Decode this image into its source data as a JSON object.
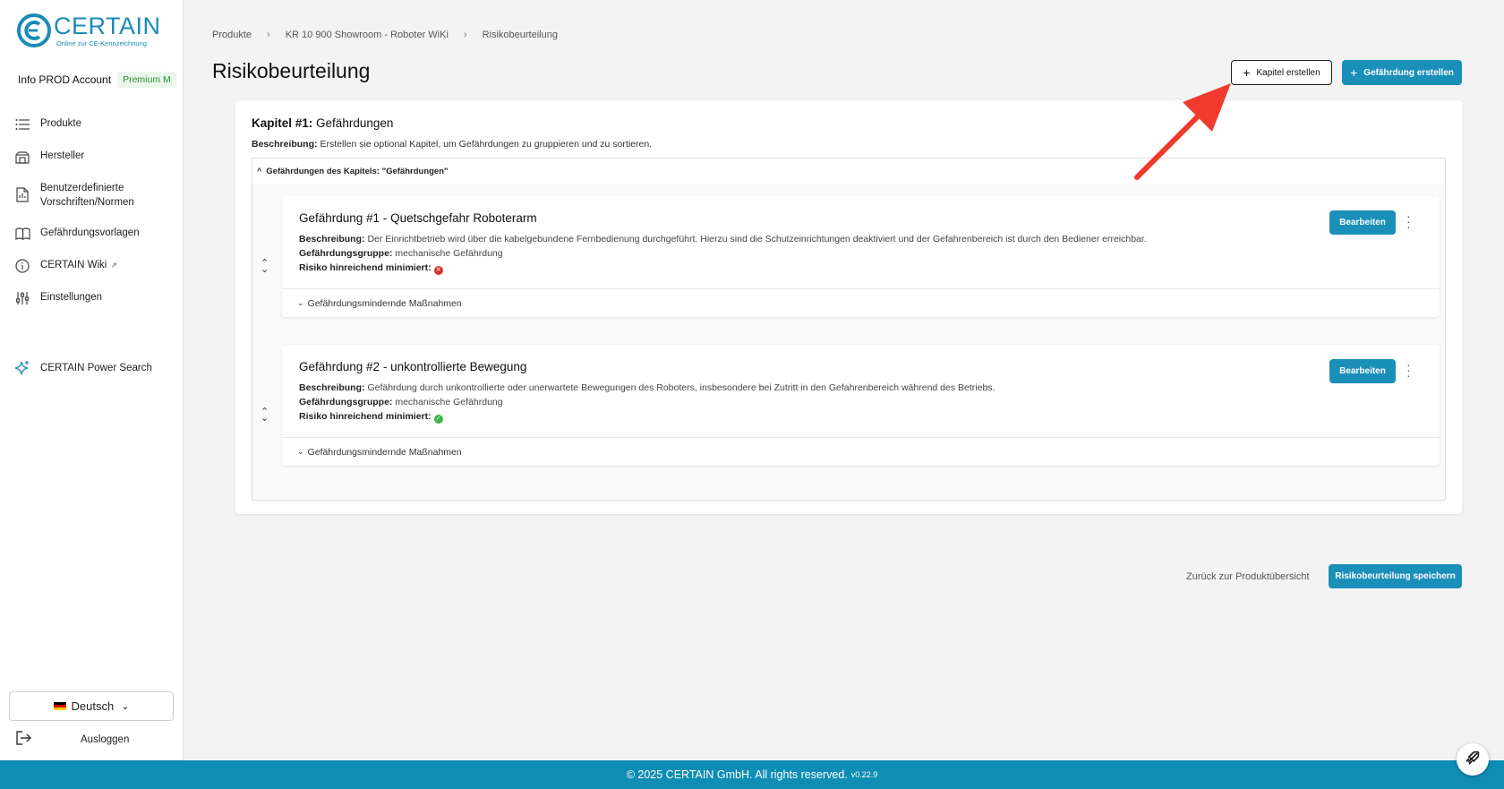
{
  "brand": {
    "name": "CERTAIN",
    "tagline": "Online zur CE-Kennzeichnung",
    "color": "#1a8bb8"
  },
  "account": {
    "name": "Info PROD Account",
    "plan": "Premium M"
  },
  "sidebar": {
    "items": [
      {
        "label": "Produkte",
        "icon": "list-icon"
      },
      {
        "label": "Hersteller",
        "icon": "factory-icon"
      },
      {
        "label": "Benutzerdefinierte Vorschriften/Normen",
        "icon": "document-icon"
      },
      {
        "label": "Gefährdungsvorlagen",
        "icon": "book-icon"
      },
      {
        "label": "CERTAIN Wiki",
        "icon": "info-icon"
      },
      {
        "label": "Einstellungen",
        "icon": "sliders-icon"
      }
    ],
    "power_search": "CERTAIN Power Search",
    "language": "Deutsch",
    "logout": "Ausloggen"
  },
  "breadcrumb": [
    "Produkte",
    "KR 10 900 Showroom - Roboter WiKi",
    "Risikobeurteilung"
  ],
  "page": {
    "title": "Risikobeurteilung",
    "btn_chapter": "Kapitel erstellen",
    "btn_hazard": "Gefährdung erstellen"
  },
  "chapter": {
    "prefix": "Kapitel #1:",
    "name": "Gefährdungen",
    "desc_label": "Beschreibung:",
    "desc": "Erstellen sie optional Kapitel, um Gefährdungen zu gruppieren und zu sortieren.",
    "group_label": "Gefährdungen des Kapitels: \"Gefährdungen\""
  },
  "labels": {
    "desc": "Beschreibung:",
    "group": "Gefährdungsgruppe:",
    "risk": "Risiko hinreichend minimiert:",
    "edit": "Bearbeiten",
    "measures": "Gefährdungsmindernde Maßnahmen"
  },
  "hazards": [
    {
      "title": "Gefährdung #1 - Quetschgefahr Roboterarm",
      "desc": "Der Einrichtbetrieb wird über die kabelgebundene Fernbedienung durchgeführt. Hierzu sind die Schutzeinrichtungen deaktiviert und der Gefahrenbereich ist durch den Bediener erreichbar.",
      "group": "mechanische Gefährdung",
      "risk_minimized": false
    },
    {
      "title": "Gefährdung #2 - unkontrollierte Bewegung",
      "desc": "Gefährdung durch unkontrollierte oder unerwartete Bewegungen des Roboters, insbesondere bei Zutritt in den Gefahrenbereich während des Betriebs.",
      "group": "mechanische Gefährdung",
      "risk_minimized": true
    }
  ],
  "actions": {
    "back": "Zurück zur Produktübersicht",
    "save": "Risikobeurteilung speichern"
  },
  "footer": {
    "text": "© 2025 CERTAIN GmbH. All rights reserved.",
    "version": "v0.22.9"
  },
  "colors": {
    "primary": "#1a8fb8",
    "footer": "#0f8db5",
    "annotation_arrow": "#f03a2e",
    "status_bad": "#d9322a",
    "status_good": "#3bb54a"
  }
}
